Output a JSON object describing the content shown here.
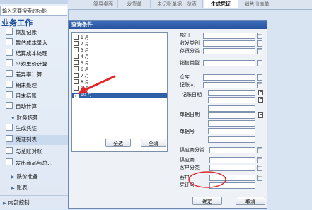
{
  "sidebar": {
    "search_text": "输入您要搜索的功能",
    "section_title": "业务工作",
    "items": [
      {
        "label": "恢复记账"
      },
      {
        "label": "暂估成本录入"
      },
      {
        "label": "结算成本处理"
      },
      {
        "label": "平均单价计算"
      },
      {
        "label": "差异率计算"
      },
      {
        "label": "期末处理"
      },
      {
        "label": "月末结账"
      },
      {
        "label": "自动计算"
      }
    ],
    "group_cost": "财务核算",
    "group_items": [
      {
        "label": "生成凭证"
      },
      {
        "label": "凭证列表"
      },
      {
        "label": "与总账对账"
      },
      {
        "label": "发出商品与总…"
      }
    ],
    "group_report": "跌价准备",
    "group_account": "账表",
    "bottom": "内部控制"
  },
  "tabs": [
    {
      "label": "简易桌面"
    },
    {
      "label": "发货单"
    },
    {
      "label": "未记账单据一览表"
    },
    {
      "label": "生成凭证"
    },
    {
      "label": "销售出库单"
    }
  ],
  "dialog": {
    "title": "查询条件",
    "months": [
      {
        "num": "1",
        "unit": "月"
      },
      {
        "num": "2",
        "unit": "月"
      },
      {
        "num": "3",
        "unit": "月"
      },
      {
        "num": "4",
        "unit": "月"
      },
      {
        "num": "5",
        "unit": "月"
      },
      {
        "num": "6",
        "unit": "月"
      },
      {
        "num": "7",
        "unit": "月"
      },
      {
        "num": "8",
        "unit": "月"
      },
      {
        "num": "9",
        "unit": "月"
      },
      {
        "num": "10",
        "unit": "月"
      }
    ],
    "checked_mark": "✓",
    "select_all": "全选",
    "deselect_all": "全消",
    "fields": {
      "dept": "部门",
      "receive_type": "收发类别",
      "stock_class": "存货分类",
      "sales_type": "销售类型",
      "warehouse": "仓库",
      "bookkeeper": "记账人",
      "book_date": "记账日期",
      "bill_date": "单据日期",
      "bill_no": "单据号",
      "supplier_class": "供应商分类",
      "supplier": "供应商",
      "customer_class": "客户分类",
      "customer": "客户",
      "voucher_no": "凭证号"
    },
    "ok": "确定",
    "cancel": "取消"
  },
  "colors": {
    "selection": "#2e5fa8",
    "annotation": "#e0262b"
  }
}
